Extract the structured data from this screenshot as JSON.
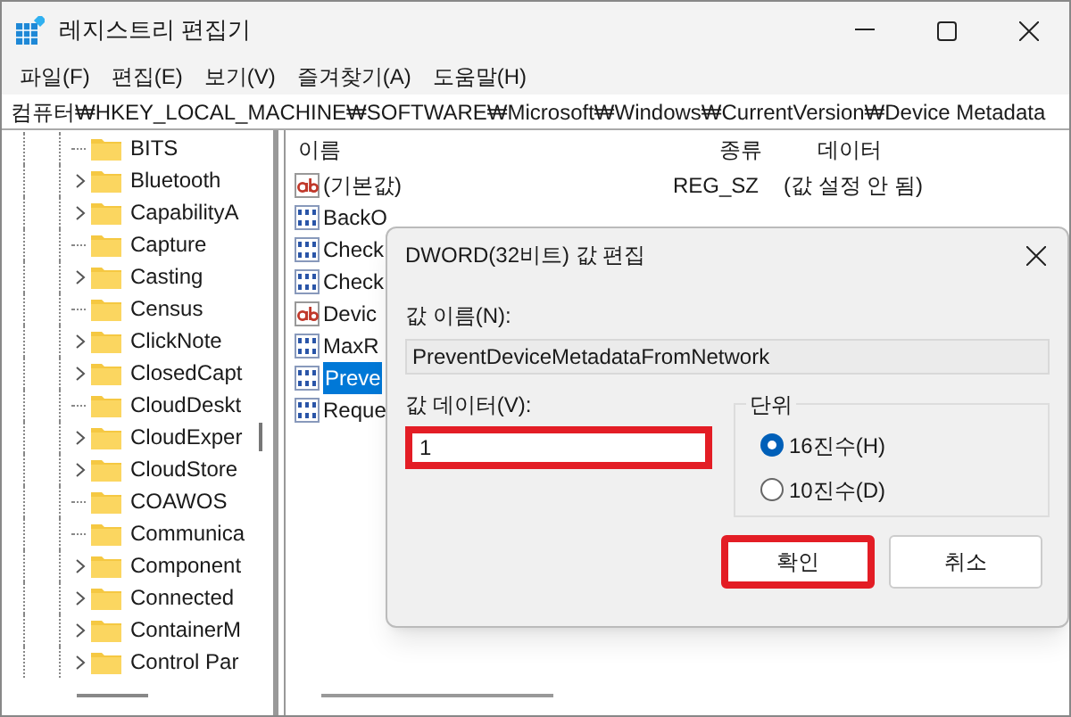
{
  "window": {
    "title": "레지스트리 편집기"
  },
  "menu": [
    {
      "label": "파일(F)"
    },
    {
      "label": "편집(E)"
    },
    {
      "label": "보기(V)"
    },
    {
      "label": "즐겨찾기(A)"
    },
    {
      "label": "도움말(H)"
    }
  ],
  "address": "컴퓨터₩HKEY_LOCAL_MACHINE₩SOFTWARE₩Microsoft₩Windows₩CurrentVersion₩Device Metadata",
  "tree": [
    {
      "label": "BITS",
      "has_children": false
    },
    {
      "label": "Bluetooth",
      "has_children": true
    },
    {
      "label": "CapabilityA",
      "has_children": true
    },
    {
      "label": "Capture",
      "has_children": false
    },
    {
      "label": "Casting",
      "has_children": true
    },
    {
      "label": "Census",
      "has_children": false
    },
    {
      "label": "ClickNote",
      "has_children": true
    },
    {
      "label": "ClosedCapt",
      "has_children": true
    },
    {
      "label": "CloudDeskt",
      "has_children": false
    },
    {
      "label": "CloudExper",
      "has_children": true
    },
    {
      "label": "CloudStore",
      "has_children": true
    },
    {
      "label": "COAWOS",
      "has_children": false
    },
    {
      "label": "Communica",
      "has_children": false
    },
    {
      "label": "Component",
      "has_children": true
    },
    {
      "label": "Connected",
      "has_children": true
    },
    {
      "label": "ContainerM",
      "has_children": true
    },
    {
      "label": "Control Par",
      "has_children": true
    }
  ],
  "list": {
    "columns": [
      "이름",
      "종류",
      "데이터"
    ],
    "rows": [
      {
        "kind": "string",
        "name": "(기본값)",
        "type": "REG_SZ",
        "data": "(값 설정 안 됨)",
        "selected": false
      },
      {
        "kind": "binary",
        "name": "BackO",
        "selected": false
      },
      {
        "kind": "binary",
        "name": "Check",
        "selected": false
      },
      {
        "kind": "binary",
        "name": "Check",
        "selected": false
      },
      {
        "kind": "string",
        "name": "Devic",
        "selected": false
      },
      {
        "kind": "binary",
        "name": "MaxR",
        "selected": false
      },
      {
        "kind": "binary",
        "name": "Preve",
        "selected": true
      },
      {
        "kind": "binary",
        "name": "Reque",
        "selected": false
      }
    ]
  },
  "dialog": {
    "title": "DWORD(32비트) 값 편집",
    "name_label": "값 이름(N):",
    "name_value": "PreventDeviceMetadataFromNetwork",
    "data_label": "값 데이터(V):",
    "data_value": "1",
    "data_highlighted": true,
    "base_group": "단위",
    "bases": [
      {
        "label": "16진수(H)",
        "selected": true
      },
      {
        "label": "10진수(D)",
        "selected": false
      }
    ],
    "buttons": [
      {
        "label": "확인",
        "highlighted": true
      },
      {
        "label": "취소",
        "highlighted": false
      }
    ]
  }
}
